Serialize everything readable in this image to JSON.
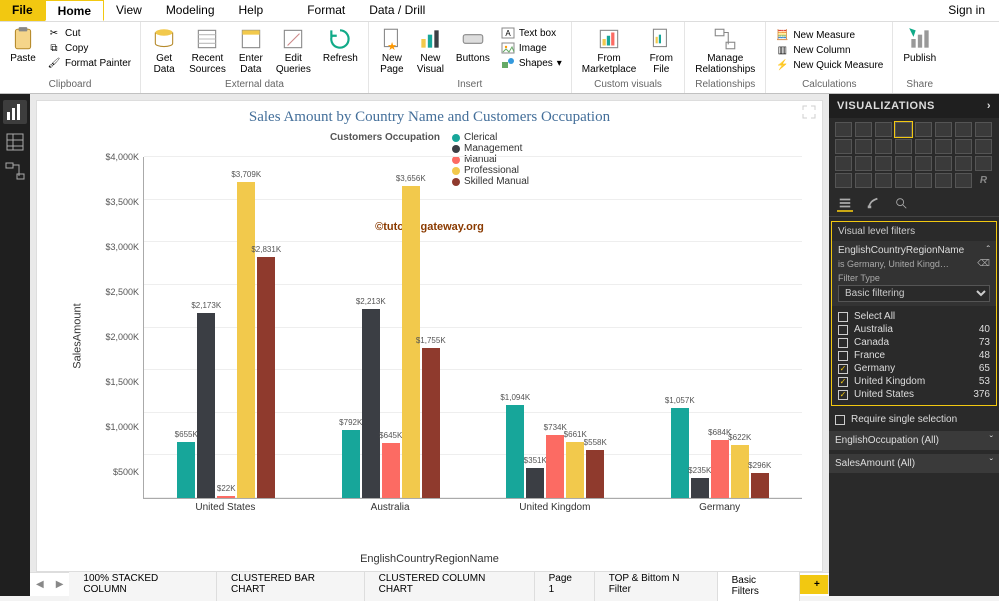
{
  "menubar": {
    "file": "File",
    "tabs": [
      "Home",
      "View",
      "Modeling",
      "Help",
      "Format",
      "Data / Drill"
    ],
    "active": "Home",
    "signin": "Sign in"
  },
  "ribbon": {
    "clipboard": {
      "label": "Clipboard",
      "paste": "Paste",
      "cut": "Cut",
      "copy": "Copy",
      "fmt": "Format Painter"
    },
    "external": {
      "label": "External data",
      "getdata": "Get\nData",
      "recent": "Recent\nSources",
      "enter": "Enter\nData",
      "edit": "Edit\nQueries",
      "refresh": "Refresh"
    },
    "insert": {
      "label": "Insert",
      "page": "New\nPage",
      "visual": "New\nVisual",
      "buttons": "Buttons",
      "textbox": "Text box",
      "image": "Image",
      "shapes": "Shapes"
    },
    "custom": {
      "label": "Custom visuals",
      "market": "From\nMarketplace",
      "file": "From\nFile"
    },
    "rel": {
      "label": "Relationships",
      "manage": "Manage\nRelationships"
    },
    "calc": {
      "label": "Calculations",
      "measure": "New Measure",
      "column": "New Column",
      "quick": "New Quick Measure"
    },
    "share": {
      "label": "Share",
      "publish": "Publish"
    }
  },
  "chart_data": {
    "type": "bar",
    "title": "Sales Amount by Country Name and Customers Occupation",
    "legend_title": "Customers Occupation",
    "xlabel": "EnglishCountryRegionName",
    "ylabel": "SalesAmount",
    "watermark": "©tutorialgateway.org",
    "ylim": [
      0,
      4000
    ],
    "yticks": [
      0,
      500,
      1000,
      1500,
      2000,
      2500,
      3000,
      3500,
      4000
    ],
    "ytick_labels": [
      "",
      "$500K",
      "$1,000K",
      "$1,500K",
      "$2,000K",
      "$2,500K",
      "$3,000K",
      "$3,500K",
      "$4,000K"
    ],
    "categories": [
      "United States",
      "Australia",
      "United Kingdom",
      "Germany"
    ],
    "series": [
      {
        "name": "Clerical",
        "color": "#17a69a",
        "values": [
          655,
          792,
          1094,
          1057
        ],
        "labels": [
          "$655K",
          "$792K",
          "$1,094K",
          "$1,057K"
        ]
      },
      {
        "name": "Management",
        "color": "#3b3e44",
        "values": [
          2173,
          2213,
          351,
          235
        ],
        "labels": [
          "$2,173K",
          "$2,213K",
          "$351K",
          "$235K"
        ]
      },
      {
        "name": "Manual",
        "color": "#fc6b63",
        "values": [
          22,
          645,
          734,
          684
        ],
        "labels": [
          "$22K",
          "$645K",
          "$734K",
          "$684K"
        ]
      },
      {
        "name": "Professional",
        "color": "#f2c94c",
        "values": [
          3709,
          3656,
          661,
          622
        ],
        "labels": [
          "$3,709K",
          "$3,656K",
          "$661K",
          "$622K"
        ]
      },
      {
        "name": "Skilled Manual",
        "color": "#8f3a2d",
        "values": [
          2831,
          1755,
          558,
          296
        ],
        "labels": [
          "$2,831K",
          "$1,755K",
          "$558K",
          "$296K"
        ]
      }
    ]
  },
  "page_tabs": {
    "tabs": [
      "100% STACKED COLUMN",
      "CLUSTERED BAR CHART",
      "CLUSTERED COLUMN CHART",
      "Page 1",
      "TOP & Bittom N Filter",
      "Basic Filters"
    ],
    "active": "Basic Filters"
  },
  "viz": {
    "header": "VISUALIZATIONS",
    "filters_title": "Visual level filters",
    "field_name": "EnglishCountryRegionName",
    "field_sub": "is Germany, United Kingd…",
    "filter_type_label": "Filter Type",
    "filter_type_value": "Basic filtering",
    "items": [
      {
        "label": "Select All",
        "count": "",
        "checked": false
      },
      {
        "label": "Australia",
        "count": "40",
        "checked": false
      },
      {
        "label": "Canada",
        "count": "73",
        "checked": false
      },
      {
        "label": "France",
        "count": "48",
        "checked": false
      },
      {
        "label": "Germany",
        "count": "65",
        "checked": true
      },
      {
        "label": "United Kingdom",
        "count": "53",
        "checked": true
      },
      {
        "label": "United States",
        "count": "376",
        "checked": true
      }
    ],
    "require_single": "Require single selection",
    "bucket_occ": "EnglishOccupation  (All)",
    "bucket_sales": "SalesAmount  (All)"
  }
}
